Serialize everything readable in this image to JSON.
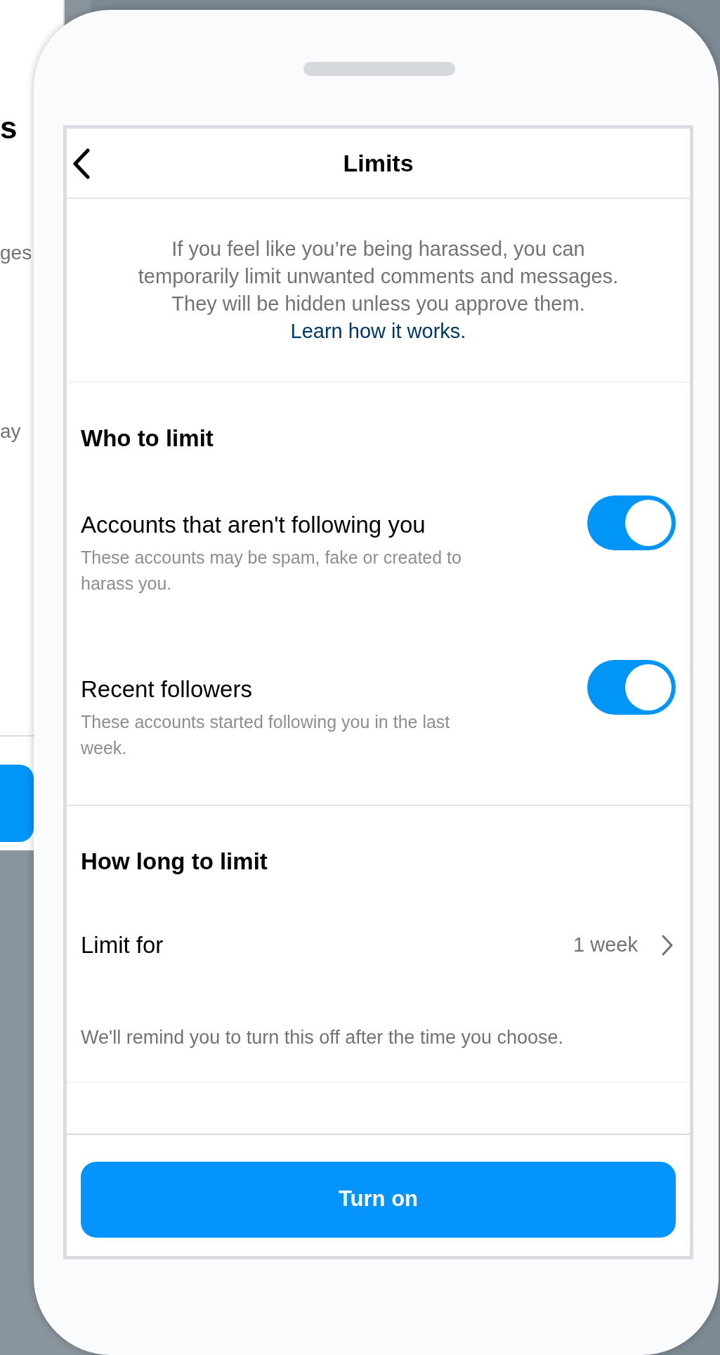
{
  "background_screen": {
    "heading": "s",
    "lines": [
      "ges",
      "ay"
    ]
  },
  "header": {
    "title": "Limits"
  },
  "intro": {
    "text": "If you feel like you’re being harassed, you can temporarily limit unwanted comments and messages. They will be hidden unless you approve them.",
    "link": "Learn how it works."
  },
  "who_section": {
    "title": "Who to limit",
    "options": [
      {
        "title": "Accounts that aren't following you",
        "description": "These accounts may be spam, fake or created to harass you.",
        "on": true
      },
      {
        "title": "Recent followers",
        "description": "These accounts started following you in the last week.",
        "on": true
      }
    ]
  },
  "duration_section": {
    "title": "How long to limit",
    "label": "Limit for",
    "value": "1 week",
    "note": "We'll remind you to turn this off after the time you choose."
  },
  "primary_button": "Turn on"
}
